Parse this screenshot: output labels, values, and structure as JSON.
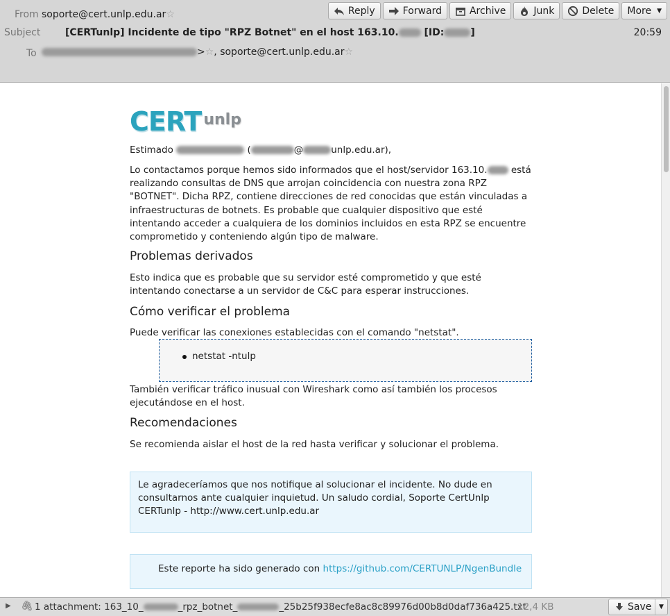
{
  "header": {
    "from_label": "From",
    "from_value": "soporte@cert.unlp.edu.ar",
    "subject_label": "Subject",
    "subject_prefix": "[CERTunlp] Incidente de tipo \"RPZ Botnet\" en el host 163.10.",
    "subject_suffix_open": "[ID:",
    "subject_suffix_close": "]",
    "time": "20:59",
    "to_label": "To",
    "to_second": ", soporte@cert.unlp.edu.ar"
  },
  "toolbar": {
    "reply": "Reply",
    "forward": "Forward",
    "archive": "Archive",
    "junk": "Junk",
    "delete": "Delete",
    "more": "More"
  },
  "body": {
    "logo_main": "CERT",
    "logo_sub": "unlp",
    "greeting_start": "Estimado",
    "greeting_open": "(",
    "greeting_at": "@",
    "greeting_end": "unlp.edu.ar),",
    "para1_a": "Lo contactamos porque hemos sido informados que el host/servidor 163.10.",
    "para1_b": " está realizando consultas de DNS que arrojan coincidencia con nuestra zona RPZ \"BOTNET\". Dicha RPZ, contiene direcciones de red conocidas que están vinculadas a infraestructuras de botnets. Es probable que cualquier dispositivo que esté intentando acceder a cualquiera de los dominios incluidos en esta RPZ se encuentre comprometido y conteniendo algún tipo de malware.",
    "heading1": "Problemas derivados",
    "para2": "Esto indica que es probable que su servidor esté comprometido y que esté intentando conectarse a un servidor de C&C para esperar instrucciones.",
    "heading2": "Cómo verificar el problema",
    "para3": "Puede verificar las conexiones establecidas con el comando \"netstat\".",
    "code_item": "netstat -ntulp",
    "para4": "También verificar tráfico inusual con Wireshark como así también los procesos ejecutándose en el host.",
    "heading3": "Recomendaciones",
    "para5": "Se recomienda aislar el host de la red hasta verificar y solucionar el problema.",
    "note": "Le agradeceríamos que nos notifique al solucionar el incidente. No dude en consultarnos ante cualquier inquietud. Un saludo cordial, Soporte CertUnlp CERTunlp - http://www.cert.unlp.edu.ar",
    "report_text": "Este reporte ha sido generado con ",
    "report_link": "https://github.com/CERTUNLP/NgenBundle"
  },
  "attachment": {
    "count_text": "1 attachment:",
    "name_a": "163_10_",
    "name_b": "_rpz_botnet_",
    "name_c": "_25b25f938ecfe8ac8c89976d00b8d0daf736a425.txt",
    "size": "12,4 KB",
    "save": "Save"
  }
}
